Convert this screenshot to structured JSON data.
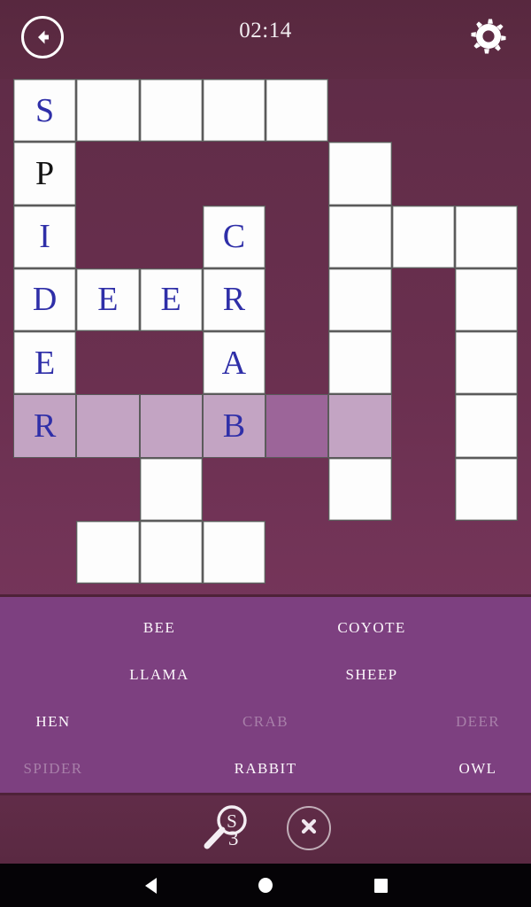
{
  "header": {
    "back_icon": "back-arrow-icon",
    "timer": "02:14",
    "settings_icon": "gear-icon"
  },
  "grid": {
    "columns": 8,
    "rows": 8,
    "cells": [
      {
        "r": 0,
        "c": 0,
        "letter": "S",
        "state": "filled"
      },
      {
        "r": 0,
        "c": 1,
        "letter": "",
        "state": "empty"
      },
      {
        "r": 0,
        "c": 2,
        "letter": "",
        "state": "empty"
      },
      {
        "r": 0,
        "c": 3,
        "letter": "",
        "state": "empty"
      },
      {
        "r": 0,
        "c": 4,
        "letter": "",
        "state": "empty"
      },
      {
        "r": 1,
        "c": 0,
        "letter": "P",
        "state": "filled-dark"
      },
      {
        "r": 1,
        "c": 5,
        "letter": "",
        "state": "empty"
      },
      {
        "r": 2,
        "c": 0,
        "letter": "I",
        "state": "filled"
      },
      {
        "r": 2,
        "c": 3,
        "letter": "C",
        "state": "filled"
      },
      {
        "r": 2,
        "c": 5,
        "letter": "",
        "state": "empty"
      },
      {
        "r": 2,
        "c": 6,
        "letter": "",
        "state": "empty"
      },
      {
        "r": 2,
        "c": 7,
        "letter": "",
        "state": "empty"
      },
      {
        "r": 3,
        "c": 0,
        "letter": "D",
        "state": "filled"
      },
      {
        "r": 3,
        "c": 1,
        "letter": "E",
        "state": "filled"
      },
      {
        "r": 3,
        "c": 2,
        "letter": "E",
        "state": "filled"
      },
      {
        "r": 3,
        "c": 3,
        "letter": "R",
        "state": "filled"
      },
      {
        "r": 3,
        "c": 5,
        "letter": "",
        "state": "empty"
      },
      {
        "r": 3,
        "c": 7,
        "letter": "",
        "state": "empty"
      },
      {
        "r": 4,
        "c": 0,
        "letter": "E",
        "state": "filled"
      },
      {
        "r": 4,
        "c": 3,
        "letter": "A",
        "state": "filled"
      },
      {
        "r": 4,
        "c": 5,
        "letter": "",
        "state": "empty"
      },
      {
        "r": 4,
        "c": 7,
        "letter": "",
        "state": "empty"
      },
      {
        "r": 5,
        "c": 0,
        "letter": "R",
        "state": "highlight"
      },
      {
        "r": 5,
        "c": 1,
        "letter": "",
        "state": "highlight"
      },
      {
        "r": 5,
        "c": 2,
        "letter": "",
        "state": "highlight"
      },
      {
        "r": 5,
        "c": 3,
        "letter": "B",
        "state": "highlight"
      },
      {
        "r": 5,
        "c": 4,
        "letter": "",
        "state": "cursor"
      },
      {
        "r": 5,
        "c": 5,
        "letter": "",
        "state": "highlight"
      },
      {
        "r": 5,
        "c": 7,
        "letter": "",
        "state": "empty"
      },
      {
        "r": 6,
        "c": 2,
        "letter": "",
        "state": "empty"
      },
      {
        "r": 6,
        "c": 5,
        "letter": "",
        "state": "empty"
      },
      {
        "r": 6,
        "c": 7,
        "letter": "",
        "state": "empty"
      },
      {
        "r": 7,
        "c": 1,
        "letter": "",
        "state": "empty"
      },
      {
        "r": 7,
        "c": 2,
        "letter": "",
        "state": "empty"
      },
      {
        "r": 7,
        "c": 3,
        "letter": "",
        "state": "empty"
      }
    ]
  },
  "word_list": {
    "rows": [
      [
        {
          "label": "",
          "found": false,
          "blank": true
        },
        {
          "label": "BEE",
          "found": false,
          "blank": false
        },
        {
          "label": "",
          "found": false,
          "blank": true
        },
        {
          "label": "COYOTE",
          "found": false,
          "blank": false
        },
        {
          "label": "",
          "found": false,
          "blank": true
        }
      ],
      [
        {
          "label": "",
          "found": false,
          "blank": true
        },
        {
          "label": "LLAMA",
          "found": false,
          "blank": false
        },
        {
          "label": "",
          "found": false,
          "blank": true
        },
        {
          "label": "SHEEP",
          "found": false,
          "blank": false
        },
        {
          "label": "",
          "found": false,
          "blank": true
        }
      ],
      [
        {
          "label": "HEN",
          "found": false,
          "blank": false
        },
        {
          "label": "",
          "found": false,
          "blank": true
        },
        {
          "label": "CRAB",
          "found": true,
          "blank": false
        },
        {
          "label": "",
          "found": false,
          "blank": true
        },
        {
          "label": "DEER",
          "found": true,
          "blank": false
        }
      ],
      [
        {
          "label": "SPIDER",
          "found": true,
          "blank": false
        },
        {
          "label": "",
          "found": false,
          "blank": true
        },
        {
          "label": "RABBIT",
          "found": false,
          "blank": false
        },
        {
          "label": "",
          "found": false,
          "blank": true
        },
        {
          "label": "OWL",
          "found": false,
          "blank": false
        }
      ]
    ]
  },
  "actions": {
    "hint_icon": "magnifier-hint-icon",
    "hint_letter": "S",
    "hint_count": "3",
    "clear_icon": "close-circle-icon"
  },
  "navbar": {
    "back": "nav-back-icon",
    "home": "nav-home-icon",
    "recent": "nav-recent-icon"
  },
  "colors": {
    "background": "#5d2b45",
    "word_panel": "#7d4080",
    "cell_open": "#fdfdfd",
    "cell_highlight": "#c3a4c3",
    "cell_cursor": "#9c6599",
    "letter": "#2f2fa8",
    "letter_dark": "#141414",
    "word_found": "#a87fa9"
  }
}
